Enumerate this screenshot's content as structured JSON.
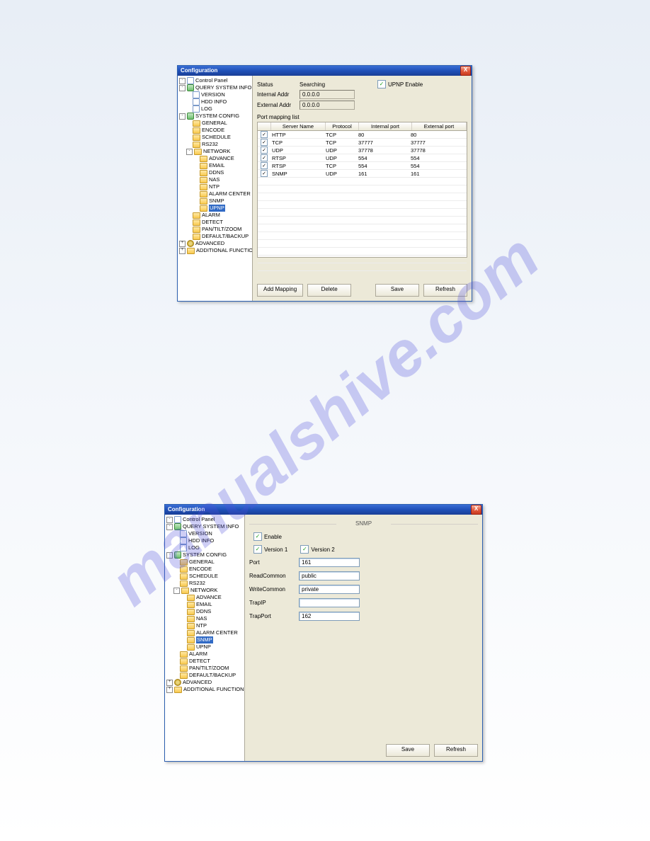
{
  "watermark": "manualshive.com",
  "dialog1": {
    "title": "Configuration",
    "close": "X",
    "status_label": "Status",
    "status_value": "Searching",
    "upnp_enable": "UPNP Enable",
    "internal_addr_label": "Internal Addr",
    "internal_addr_value": "0.0.0.0",
    "external_addr_label": "External Addr",
    "external_addr_value": "0.0.0.0",
    "mapping_list_label": "Port mapping list",
    "columns": {
      "chk": "",
      "server": "Server Name",
      "proto": "Protocol",
      "int": "Internal port",
      "ext": "External port"
    },
    "rows": [
      {
        "name": "HTTP",
        "proto": "TCP",
        "int": "80",
        "ext": "80"
      },
      {
        "name": "TCP",
        "proto": "TCP",
        "int": "37777",
        "ext": "37777"
      },
      {
        "name": "UDP",
        "proto": "UDP",
        "int": "37778",
        "ext": "37778"
      },
      {
        "name": "RTSP",
        "proto": "UDP",
        "int": "554",
        "ext": "554"
      },
      {
        "name": "RTSP",
        "proto": "TCP",
        "int": "554",
        "ext": "554"
      },
      {
        "name": "SNMP",
        "proto": "UDP",
        "int": "161",
        "ext": "161"
      }
    ],
    "buttons": {
      "add": "Add Mapping",
      "delete": "Delete",
      "save": "Save",
      "refresh": "Refresh"
    }
  },
  "dialog2": {
    "title": "Configuration",
    "panel_title": "SNMP",
    "enable": "Enable",
    "v1": "Version 1",
    "v2": "Version 2",
    "port_label": "Port",
    "port_value": "161",
    "readcommon_label": "ReadCommon",
    "readcommon_value": "public",
    "writecommon_label": "WriteCommon",
    "writecommon_value": "private",
    "trapip_label": "TrapIP",
    "trapip_value": "",
    "trapport_label": "TrapPort",
    "trapport_value": "162",
    "buttons": {
      "save": "Save",
      "refresh": "Refresh"
    }
  },
  "tree1": [
    {
      "d": 0,
      "t": "-",
      "ic": "page",
      "lbl": "Control Panel"
    },
    {
      "d": 0,
      "t": "-",
      "ic": "tool",
      "lbl": "QUERY SYSTEM INFO"
    },
    {
      "d": 1,
      "t": "",
      "ic": "page",
      "lbl": "VERSION"
    },
    {
      "d": 1,
      "t": "",
      "ic": "page",
      "lbl": "HDD INFO"
    },
    {
      "d": 1,
      "t": "",
      "ic": "page",
      "lbl": "LOG"
    },
    {
      "d": 0,
      "t": "-",
      "ic": "tool",
      "lbl": "SYSTEM CONFIG"
    },
    {
      "d": 1,
      "t": "",
      "ic": "folder",
      "lbl": "GENERAL"
    },
    {
      "d": 1,
      "t": "",
      "ic": "folder",
      "lbl": "ENCODE"
    },
    {
      "d": 1,
      "t": "",
      "ic": "folder",
      "lbl": "SCHEDULE"
    },
    {
      "d": 1,
      "t": "",
      "ic": "folder",
      "lbl": "RS232"
    },
    {
      "d": 1,
      "t": "-",
      "ic": "folder",
      "lbl": "NETWORK"
    },
    {
      "d": 2,
      "t": "",
      "ic": "folder",
      "lbl": "ADVANCE"
    },
    {
      "d": 2,
      "t": "",
      "ic": "folder",
      "lbl": "EMAIL"
    },
    {
      "d": 2,
      "t": "",
      "ic": "folder",
      "lbl": "DDNS"
    },
    {
      "d": 2,
      "t": "",
      "ic": "folder",
      "lbl": "NAS"
    },
    {
      "d": 2,
      "t": "",
      "ic": "folder",
      "lbl": "NTP"
    },
    {
      "d": 2,
      "t": "",
      "ic": "folder",
      "lbl": "ALARM CENTER"
    },
    {
      "d": 2,
      "t": "",
      "ic": "folder",
      "lbl": "SNMP"
    },
    {
      "d": 2,
      "t": "",
      "ic": "folder",
      "lbl": "UPNP",
      "sel": true
    },
    {
      "d": 1,
      "t": "",
      "ic": "folder",
      "lbl": "ALARM"
    },
    {
      "d": 1,
      "t": "",
      "ic": "folder",
      "lbl": "DETECT"
    },
    {
      "d": 1,
      "t": "",
      "ic": "folder",
      "lbl": "PAN/TILT/ZOOM"
    },
    {
      "d": 1,
      "t": "",
      "ic": "folder",
      "lbl": "DEFAULT/BACKUP"
    },
    {
      "d": 0,
      "t": "+",
      "ic": "gear",
      "lbl": "ADVANCED"
    },
    {
      "d": 0,
      "t": "+",
      "ic": "folder",
      "lbl": "ADDITIONAL FUNCTION"
    }
  ],
  "tree2": [
    {
      "d": 0,
      "t": "-",
      "ic": "page",
      "lbl": "Control Panel"
    },
    {
      "d": 0,
      "t": "-",
      "ic": "tool",
      "lbl": "QUERY SYSTEM INFO"
    },
    {
      "d": 1,
      "t": "",
      "ic": "page",
      "lbl": "VERSION"
    },
    {
      "d": 1,
      "t": "",
      "ic": "page",
      "lbl": "HDD INFO"
    },
    {
      "d": 1,
      "t": "",
      "ic": "page",
      "lbl": "LOG"
    },
    {
      "d": 0,
      "t": "-",
      "ic": "tool",
      "lbl": "SYSTEM CONFIG"
    },
    {
      "d": 1,
      "t": "",
      "ic": "folder",
      "lbl": "GENERAL"
    },
    {
      "d": 1,
      "t": "",
      "ic": "folder",
      "lbl": "ENCODE"
    },
    {
      "d": 1,
      "t": "",
      "ic": "folder",
      "lbl": "SCHEDULE"
    },
    {
      "d": 1,
      "t": "",
      "ic": "folder",
      "lbl": "RS232"
    },
    {
      "d": 1,
      "t": "-",
      "ic": "folder",
      "lbl": "NETWORK"
    },
    {
      "d": 2,
      "t": "",
      "ic": "folder",
      "lbl": "ADVANCE"
    },
    {
      "d": 2,
      "t": "",
      "ic": "folder",
      "lbl": "EMAIL"
    },
    {
      "d": 2,
      "t": "",
      "ic": "folder",
      "lbl": "DDNS"
    },
    {
      "d": 2,
      "t": "",
      "ic": "folder",
      "lbl": "NAS"
    },
    {
      "d": 2,
      "t": "",
      "ic": "folder",
      "lbl": "NTP"
    },
    {
      "d": 2,
      "t": "",
      "ic": "folder",
      "lbl": "ALARM CENTER"
    },
    {
      "d": 2,
      "t": "",
      "ic": "folder",
      "lbl": "SNMP",
      "sel": true
    },
    {
      "d": 2,
      "t": "",
      "ic": "folder",
      "lbl": "UPNP"
    },
    {
      "d": 1,
      "t": "",
      "ic": "folder",
      "lbl": "ALARM"
    },
    {
      "d": 1,
      "t": "",
      "ic": "folder",
      "lbl": "DETECT"
    },
    {
      "d": 1,
      "t": "",
      "ic": "folder",
      "lbl": "PAN/TILT/ZOOM"
    },
    {
      "d": 1,
      "t": "",
      "ic": "folder",
      "lbl": "DEFAULT/BACKUP"
    },
    {
      "d": 0,
      "t": "+",
      "ic": "gear",
      "lbl": "ADVANCED"
    },
    {
      "d": 0,
      "t": "+",
      "ic": "folder",
      "lbl": "ADDITIONAL FUNCTION"
    }
  ]
}
